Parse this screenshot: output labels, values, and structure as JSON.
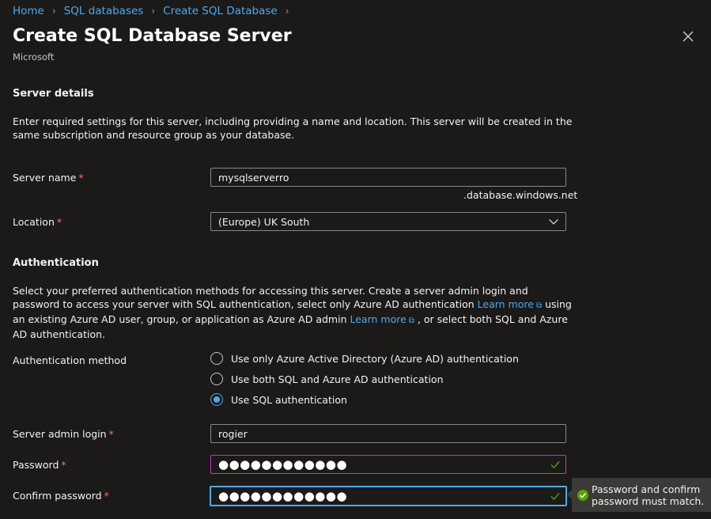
{
  "breadcrumb": {
    "items": [
      "Home",
      "SQL databases",
      "Create SQL Database"
    ],
    "separator": ">"
  },
  "header": {
    "title": "Create SQL Database Server",
    "more": "···",
    "publisher": "Microsoft"
  },
  "server_details": {
    "title": "Server details",
    "description": "Enter required settings for this server, including providing a name and location. This server will be created in the same subscription and resource group as your database.",
    "server_name": {
      "label": "Server name",
      "value": "mysqlserverro",
      "suffix": ".database.windows.net"
    },
    "location": {
      "label": "Location",
      "selected": "(Europe) UK South"
    }
  },
  "authentication": {
    "title": "Authentication",
    "description_parts": [
      "Select your preferred authentication methods for accessing this server. Create a server admin login and password to access your server with SQL authentication, select only Azure AD authentication ",
      "Learn more",
      " using an existing Azure AD user, group, or application as Azure AD admin ",
      "Learn more",
      " , or select both SQL and Azure AD authentication."
    ],
    "method_label": "Authentication method",
    "options": [
      "Use only Azure Active Directory (Azure AD) authentication",
      "Use both SQL and Azure AD authentication",
      "Use SQL authentication"
    ],
    "selected_option": 2,
    "admin_login": {
      "label": "Server admin login",
      "value": "rogier"
    },
    "password": {
      "label": "Password",
      "value": "●●●●●●●●●●●●"
    },
    "confirm_password": {
      "label": "Confirm password",
      "value": "●●●●●●●●●●●●"
    }
  },
  "required_marker": "*",
  "tooltip": {
    "text": "Password and confirm password must match."
  },
  "colors": {
    "background": "#1b1a19",
    "link": "#4fa8ee",
    "required": "#f1707b",
    "password_focus_border": "#c239b3",
    "confirm_focus_border": "#4fa8ee",
    "success": "#57a300"
  }
}
